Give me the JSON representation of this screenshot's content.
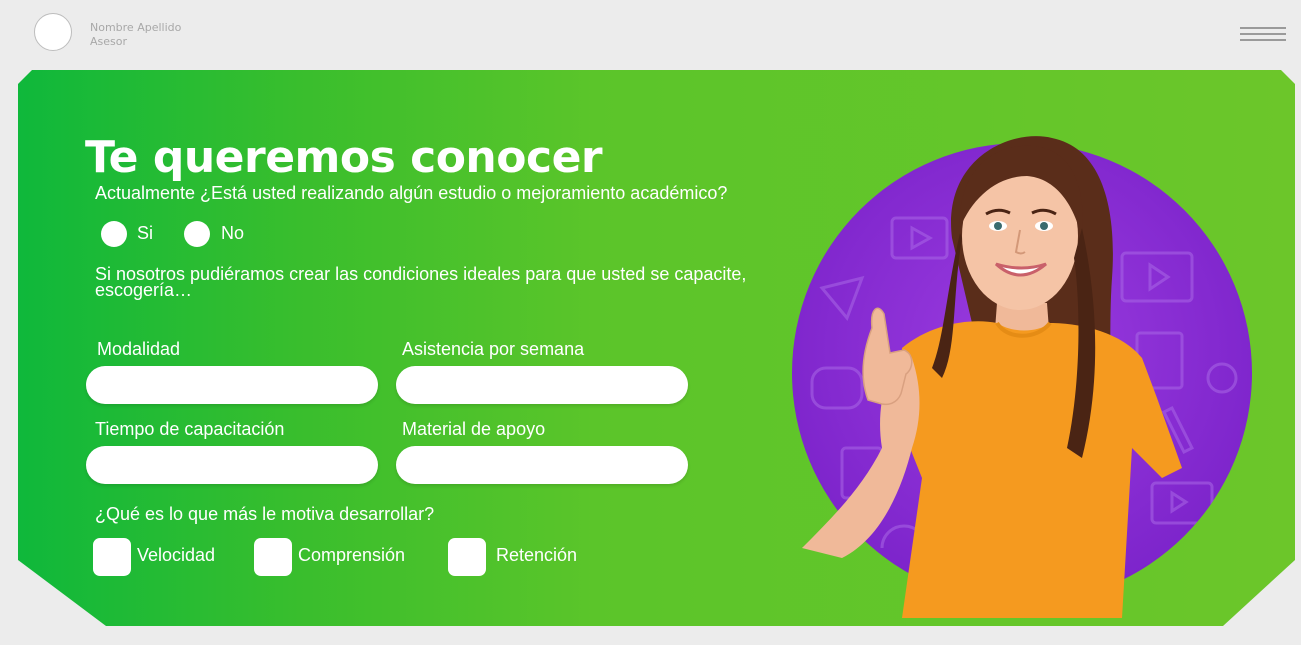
{
  "header": {
    "user_name": "Nombre Apellido",
    "user_role": "Asesor",
    "menu_icon": "hamburger-menu-icon"
  },
  "colors": {
    "background": "#ececec",
    "card_gradient_start": "#0fb83b",
    "card_gradient_end": "#6cc62a",
    "circle_purple": "#8a2dd4",
    "shirt_orange": "#f59a1f",
    "text": "#ffffff"
  },
  "form": {
    "title": "Te queremos conocer",
    "question_study": "Actualmente ¿Está usted realizando algún estudio o mejoramiento académico?",
    "options_study": [
      "Si",
      "No"
    ],
    "question_conditions": "Si nosotros pudiéramos crear las condiciones ideales para que usted se capacite, escogería…",
    "fields": [
      {
        "label": "Modalidad",
        "value": ""
      },
      {
        "label": "Asistencia por semana",
        "value": ""
      },
      {
        "label": "Tiempo de capacitación",
        "value": ""
      },
      {
        "label": "Material de apoyo",
        "value": ""
      }
    ],
    "question_motivation": "¿Qué es lo que más le motiva desarrollar?",
    "motivation_options": [
      "Velocidad",
      "Comprensión",
      "Retención"
    ]
  }
}
